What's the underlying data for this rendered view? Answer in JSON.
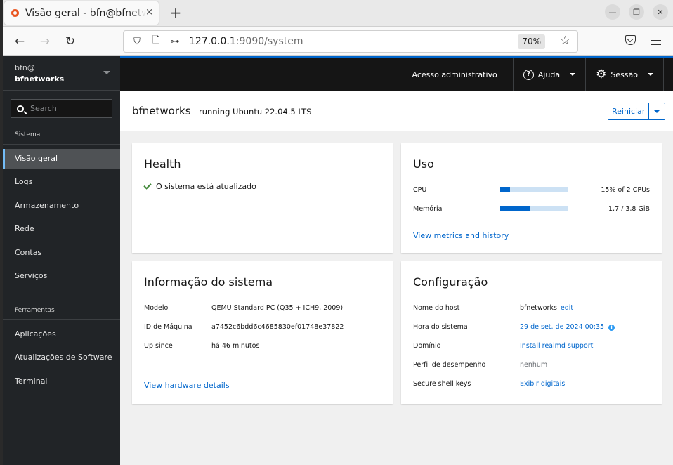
{
  "browser": {
    "tab_title": "Visão geral - bfn@bfnetworks",
    "tab_close": "×",
    "new_tab": "+",
    "url_host": "127.0.0.1",
    "url_rest": ":9090/system",
    "zoom_level": "70%",
    "icons": {
      "back": "←",
      "forward": "→",
      "reload": "↻",
      "shield": "⛉",
      "page": "🗋",
      "key": "⊶",
      "star": "☆",
      "minimize": "—",
      "restore": "❐",
      "close": "✕"
    }
  },
  "sidebar": {
    "host_user": "bfn@",
    "host_name": "bfnetworks",
    "search_placeholder": "Search",
    "sections": [
      {
        "label": "Sistema",
        "items": [
          {
            "label": "Visão geral",
            "active": true
          },
          {
            "label": "Logs"
          },
          {
            "label": "Armazenamento"
          },
          {
            "label": "Rede"
          },
          {
            "label": "Contas"
          },
          {
            "label": "Serviços"
          }
        ]
      },
      {
        "label": "Ferramentas",
        "items": [
          {
            "label": "Aplicações"
          },
          {
            "label": "Atualizações de Software"
          },
          {
            "label": "Terminal"
          }
        ]
      }
    ]
  },
  "masthead": {
    "admin_access": "Acesso administrativo",
    "help": "Ajuda",
    "help_icon": "?",
    "session": "Sessão",
    "gear_icon": "⚙",
    "accent_color": "#0066cc"
  },
  "page_header": {
    "hostname": "bfnetworks",
    "os": "running Ubuntu 22.04.5 LTS",
    "restart_label": "Reiniciar"
  },
  "health": {
    "title": "Health",
    "status": "O sistema está atualizado",
    "status_color": "#3e8635"
  },
  "usage": {
    "title": "Uso",
    "rows": [
      {
        "label": "CPU",
        "fraction": 0.15,
        "value": "15% of 2 CPUs"
      },
      {
        "label": "Memória",
        "fraction": 0.447,
        "value": "1,7 / 3,8 GiB"
      }
    ],
    "link": "View metrics and history"
  },
  "system_info": {
    "title": "Informação do sistema",
    "rows": [
      {
        "label": "Modelo",
        "value": "QEMU Standard PC (Q35 + ICH9, 2009)"
      },
      {
        "label": "ID de Máquina",
        "value": "a7452c6bdd6c4685830ef01748e37822"
      },
      {
        "label": "Up since",
        "value": "há 46 minutos"
      }
    ],
    "link": "View hardware details"
  },
  "configuration": {
    "title": "Configuração",
    "rows": [
      {
        "label": "Nome do host",
        "value": "bfnetworks",
        "action": "edit"
      },
      {
        "label": "Hora do sistema",
        "value": "29 de set. de 2024 00:35",
        "info_icon": "i"
      },
      {
        "label": "Domínio",
        "value": "Install realmd support"
      },
      {
        "label": "Perfil de desempenho",
        "value": "nenhum"
      },
      {
        "label": "Secure shell keys",
        "value": "Exibir digitais"
      }
    ]
  }
}
